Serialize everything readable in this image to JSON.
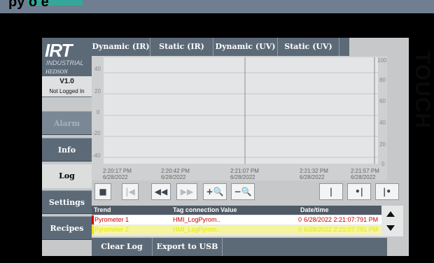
{
  "header": {
    "title_fragment": "py  o  e"
  },
  "brand": {
    "logo": "IRT",
    "industrial": "INDUSTRIAL",
    "hedson": "HEDSON",
    "touch": "TOUCH"
  },
  "status": {
    "version": "V1.0",
    "login": "Not Logged In"
  },
  "nav": [
    "Alarm",
    "Info",
    "Log",
    "Settings",
    "Recipes"
  ],
  "tabs": [
    "Dynamic (IR)",
    "Static (IR)",
    "Dynamic (UV)",
    "Static (UV)"
  ],
  "trend": {
    "left_axis": [
      "40",
      "20",
      "0",
      "-20",
      "-40"
    ],
    "right_axis": [
      "100",
      "80",
      "60",
      "40",
      "20",
      "0"
    ],
    "times": [
      [
        "2:20:17 PM",
        "6/28/2022"
      ],
      [
        "2:20:42 PM",
        "6/28/2022"
      ],
      [
        "2:21:07 PM",
        "6/28/2022"
      ],
      [
        "2:21:32 PM",
        "6/28/2022"
      ],
      [
        "2:21:57 PM",
        "6/28/2022"
      ]
    ]
  },
  "toolbar": [
    "■",
    "|◀",
    "◀◀",
    "▶▶",
    "+🔍",
    "−🔍",
    "|",
    "•|",
    "|•"
  ],
  "table": {
    "headers": [
      "Trend",
      "Tag connection",
      "Value",
      "Date/time"
    ],
    "rows": [
      {
        "trend": "Pyrometer 1",
        "tag": "HMI_LogPyrom..",
        "value": "0",
        "time": "6/28/2022 2:21:07:791 PM",
        "color": "#cc0000"
      },
      {
        "trend": "Pyrometer 2",
        "tag": "HMI_LogPyrom..",
        "value": "0",
        "time": "6/28/2022 2:21:07:791 PM",
        "color": "#e8e800"
      }
    ]
  },
  "actions": {
    "clear": "Clear Log",
    "export": "Export to USB"
  },
  "colors": {
    "panel": "#5c6a78",
    "background": "#6f7e91"
  }
}
